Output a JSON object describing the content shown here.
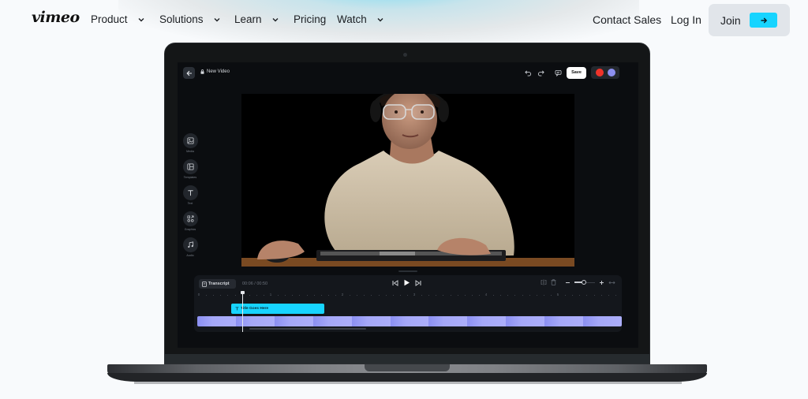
{
  "nav": {
    "logo": "vimeo",
    "items": [
      {
        "label": "Product",
        "has_dropdown": true
      },
      {
        "label": "Solutions",
        "has_dropdown": true
      },
      {
        "label": "Learn",
        "has_dropdown": true
      },
      {
        "label": "Pricing",
        "has_dropdown": false
      },
      {
        "label": "Watch",
        "has_dropdown": true
      }
    ],
    "contact_sales": "Contact Sales",
    "log_in": "Log In",
    "join": "Join",
    "join_icon": "arrow-right-icon",
    "accent_color": "#17d4ff"
  },
  "editor": {
    "back_icon": "arrow-left-icon",
    "title": "New Video",
    "title_icon": "lock-icon",
    "toolbar": {
      "undo_icon": "undo-icon",
      "redo_icon": "redo-icon",
      "comment_icon": "comment-icon",
      "save_label": "Save",
      "collaborators": [
        {
          "name": "collaborator-1",
          "color": "#f0332a"
        },
        {
          "name": "collaborator-2",
          "color": "#8c8ff0"
        }
      ]
    },
    "sidebar": [
      {
        "label": "Media",
        "icon": "image-icon"
      },
      {
        "label": "Templates",
        "icon": "layout-icon"
      },
      {
        "label": "Text",
        "icon": "text-icon"
      },
      {
        "label": "Graphics",
        "icon": "shapes-icon"
      },
      {
        "label": "Audio",
        "icon": "music-note-icon"
      }
    ],
    "preview": {
      "description": "Man with glasses and headphones typing at a keyboard"
    },
    "timeline": {
      "transcript_label": "Transcript",
      "current_time": "00:06",
      "total_time": "00:50",
      "time_display": "00:06 / 00:50",
      "ruler_labels": [
        "0",
        "1",
        "2",
        "3",
        "4",
        "5"
      ],
      "playhead_seconds": 0.6,
      "zoom_level_fraction": 0.45,
      "title_clip": {
        "label": "Title Goes Here",
        "start_seconds": 0.45,
        "end_seconds": 1.75
      },
      "video_clip_color": "#a5a8f8"
    }
  }
}
